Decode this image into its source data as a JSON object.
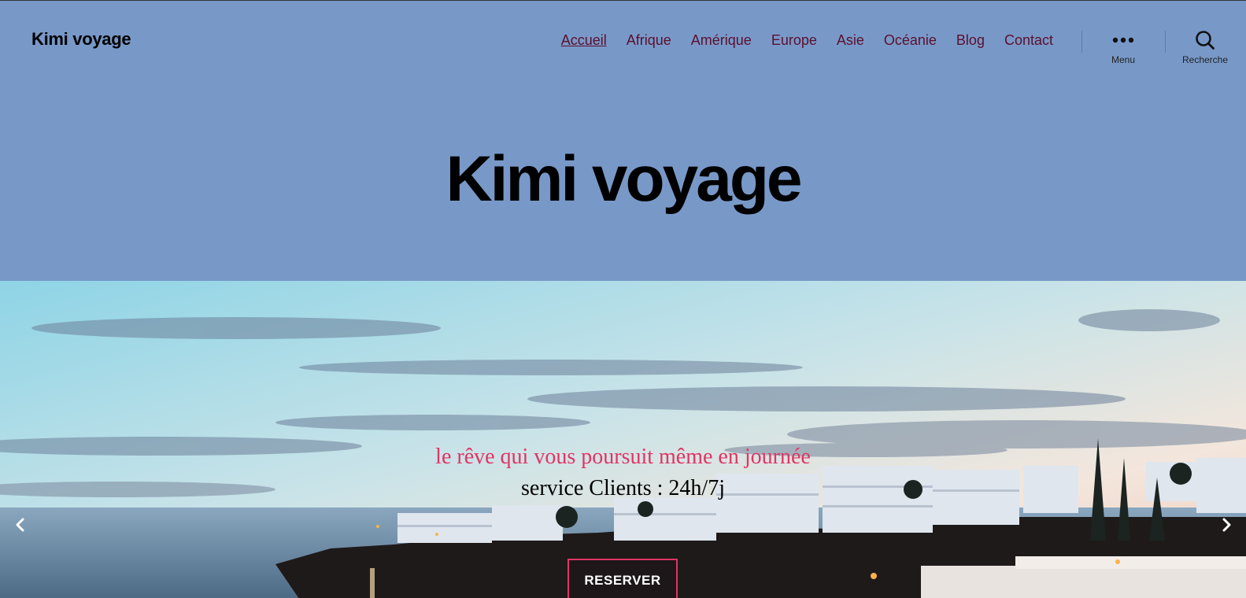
{
  "header": {
    "site_title": "Kimi voyage",
    "nav": [
      {
        "label": "Accueil",
        "current": true
      },
      {
        "label": "Afrique"
      },
      {
        "label": "Amérique"
      },
      {
        "label": "Europe"
      },
      {
        "label": "Asie"
      },
      {
        "label": "Océanie"
      },
      {
        "label": "Blog"
      },
      {
        "label": "Contact"
      }
    ],
    "menu_label": "Menu",
    "search_label": "Recherche"
  },
  "hero": {
    "title": "Kimi voyage"
  },
  "banner": {
    "tagline": "le rêve qui vous poursuit même en journée",
    "service": "service Clients : 24h/7j",
    "button": "RESERVER"
  },
  "colors": {
    "background": "#7899c8",
    "nav_link": "#5c0f2e",
    "accent": "#e03565"
  },
  "icons": {
    "menu": "ellipsis-icon",
    "search": "search-icon",
    "prev": "chevron-left-icon",
    "next": "chevron-right-icon"
  }
}
